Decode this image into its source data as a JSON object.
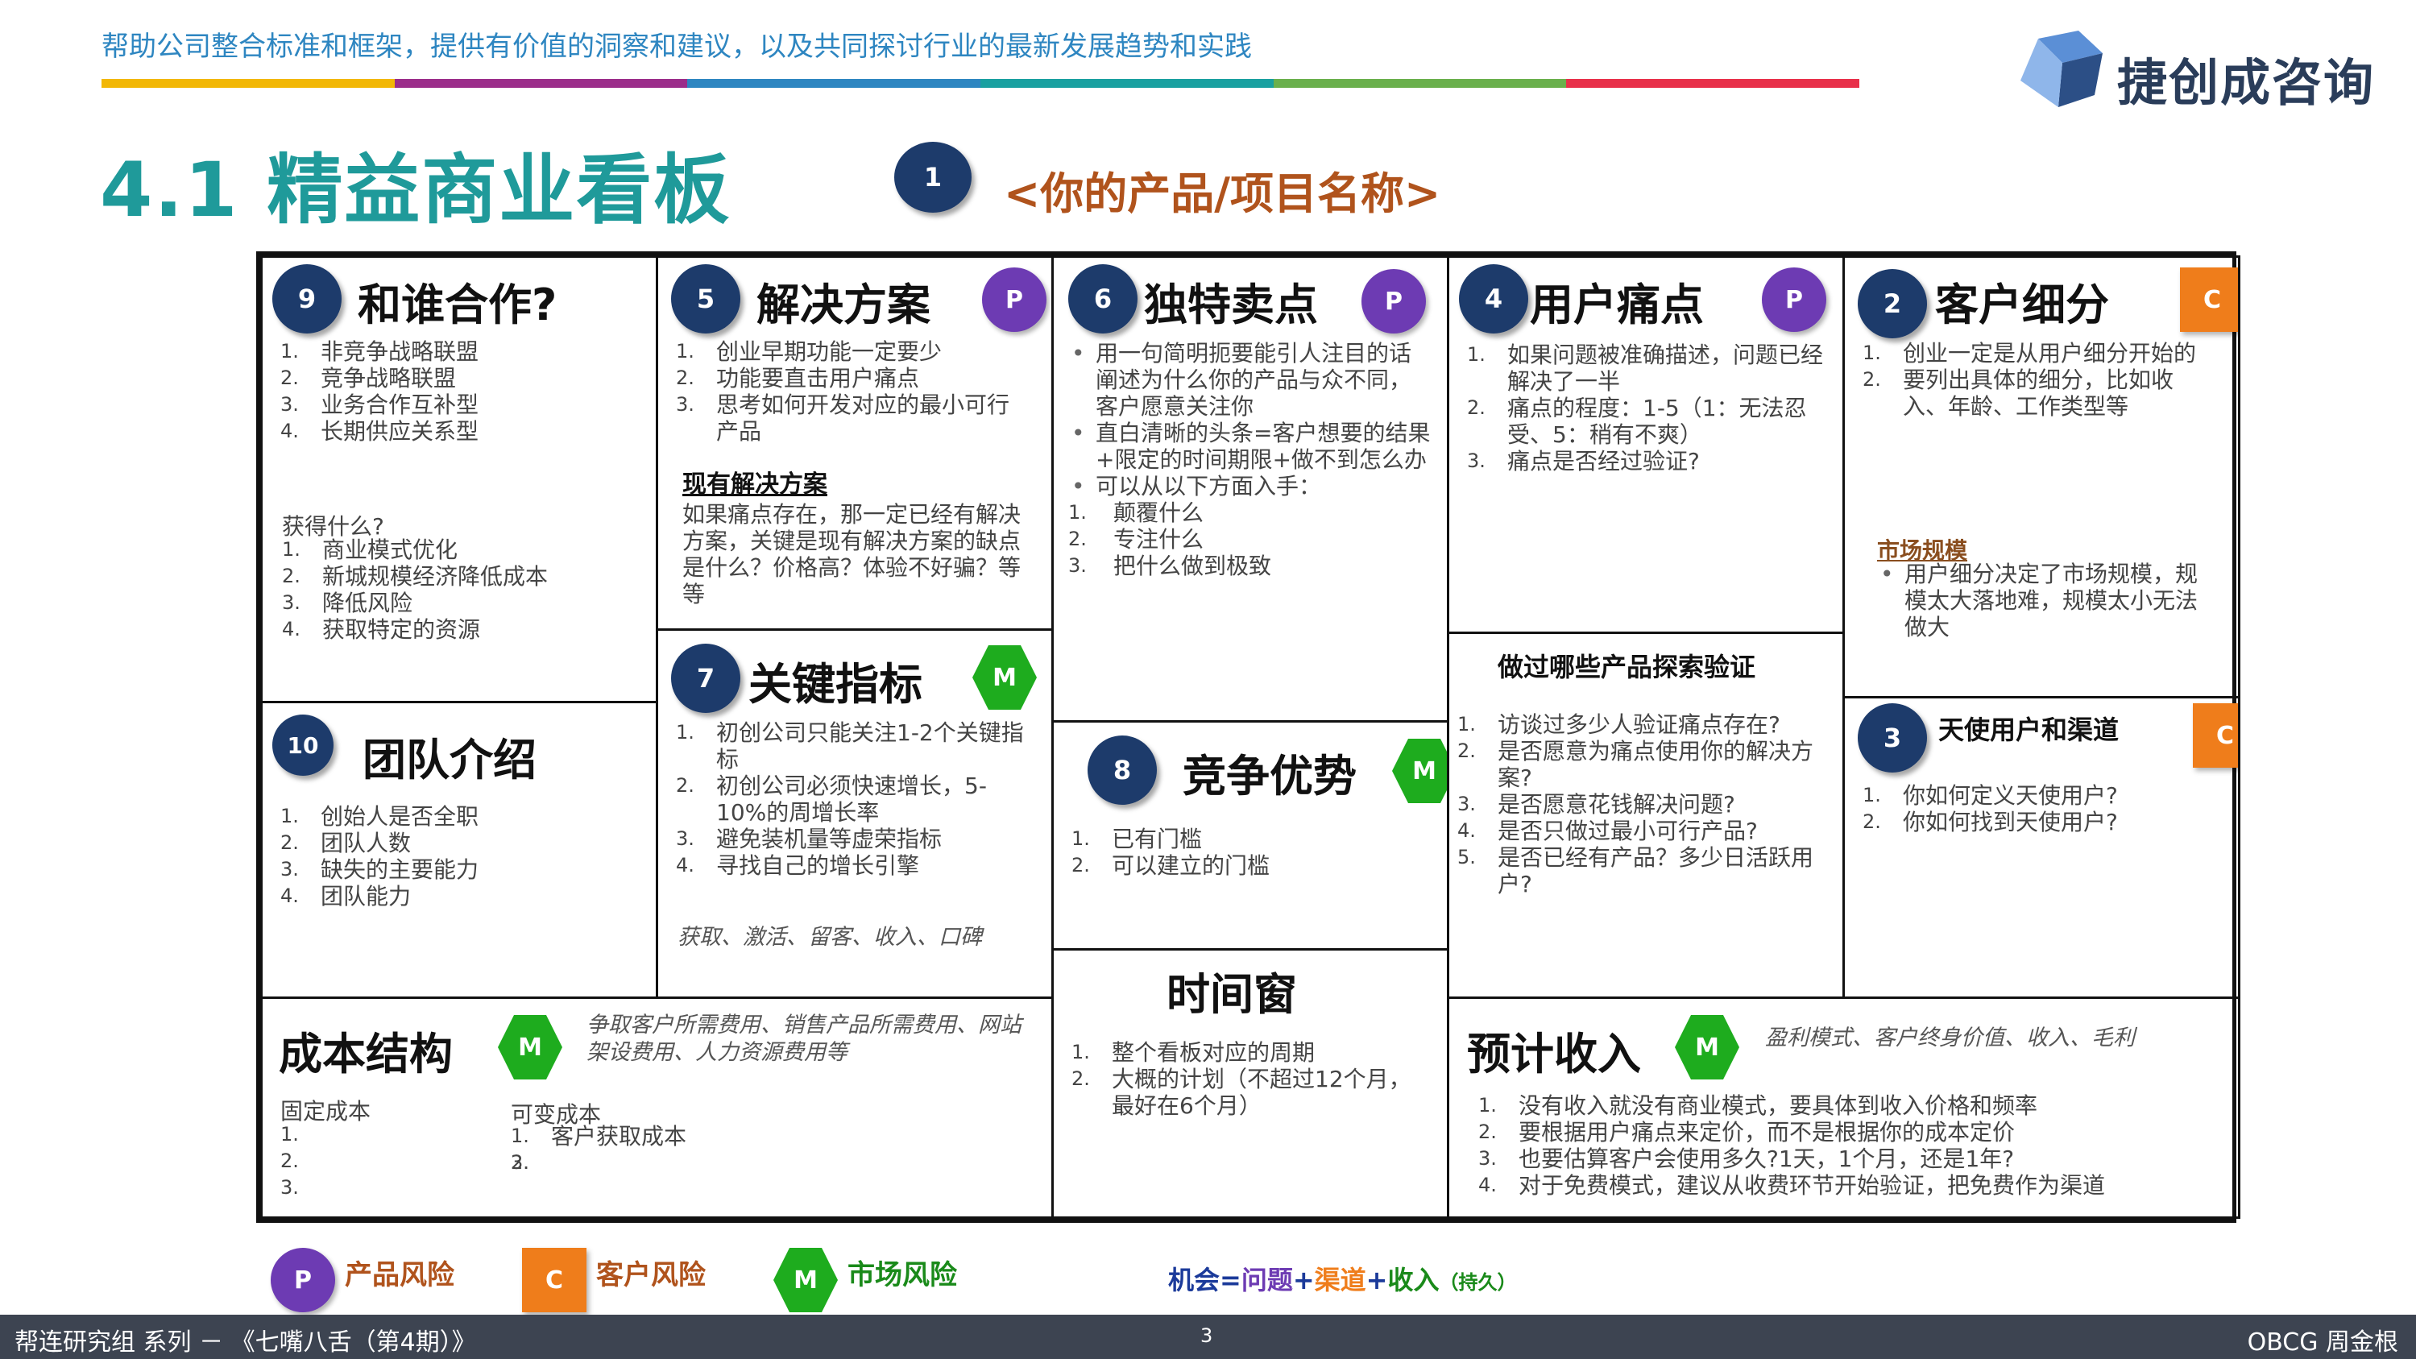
{
  "header": {
    "tagline": "帮助公司整合标准和框架，提供有价值的洞察和建议，以及共同探讨行业的最新发展趋势和实践",
    "logo_text": "捷创成咨询",
    "color_stripes": [
      "#f2b705",
      "#9b2d8a",
      "#2e86c1",
      "#19a0a0",
      "#6ab04c",
      "#e8304a"
    ]
  },
  "title": "4.1 精益商业看板",
  "product": {
    "badge": "1",
    "name": "<你的产品/项目名称>"
  },
  "cells": {
    "partners": {
      "badge": "9",
      "title": "和谁合作?",
      "items": [
        "非竞争战略联盟",
        "竞争战略联盟",
        "业务合作互补型",
        "长期供应关系型"
      ],
      "gain_label": "获得什么?",
      "gain_items": [
        "商业模式优化",
        "新城规模经济降低成本",
        "降低风险",
        "获取特定的资源"
      ]
    },
    "team": {
      "badge": "10",
      "title": "团队介绍",
      "items": [
        "创始人是否全职",
        "团队人数",
        "缺失的主要能力",
        "团队能力"
      ]
    },
    "solution": {
      "badge": "5",
      "title": "解决方案",
      "risk": "P",
      "items": [
        "创业早期功能一定要少",
        "功能要直击用户痛点",
        "思考如何开发对应的最小可行产品"
      ],
      "existing_label": "现有解决方案",
      "existing_text": "如果痛点存在，那一定已经有解决方案，关键是现有解决方案的缺点是什么？价格高？体验不好骗？等等"
    },
    "metrics": {
      "badge": "7",
      "title": "关键指标",
      "risk": "M",
      "items": [
        "初创公司只能关注1-2个关键指标",
        "初创公司必须快速增长，5-10%的周增长率",
        "避免装机量等虚荣指标",
        "寻找自己的增长引擎"
      ],
      "note": "获取、激活、留客、收入、口碑"
    },
    "usp": {
      "badge": "6",
      "title": "独特卖点",
      "risk": "P",
      "bullet1": "用一句简明扼要能引人注目的话阐述为什么你的产品与众不同，客户愿意关注你",
      "bullet2": "直白清晰的头条=客户想要的结果+限定的时间期限+做不到怎么办",
      "bullet3": "可以从以下方面入手：",
      "items": [
        "颠覆什么",
        "专注什么",
        "把什么做到极致"
      ]
    },
    "advantage": {
      "badge": "8",
      "title": "竞争优势",
      "risk": "M",
      "items": [
        "已有门槛",
        "可以建立的门槛"
      ]
    },
    "window": {
      "title": "时间窗",
      "items": [
        "整个看板对应的周期",
        "大概的计划（不超过12个月，最好在6个月）"
      ]
    },
    "pain": {
      "badge": "4",
      "title": "用户痛点",
      "risk": "P",
      "items": [
        "如果问题被准确描述，问题已经解决了一半",
        "痛点的程度：1-5（1：无法忍受、5：稍有不爽）",
        "痛点是否经过验证?"
      ]
    },
    "validation": {
      "title": "做过哪些产品探索验证",
      "items": [
        "访谈过多少人验证痛点存在?",
        "是否愿意为痛点使用你的解决方案?",
        "是否愿意花钱解决问题?",
        "是否只做过最小可行产品?",
        "是否已经有产品？多少日活跃用户?"
      ]
    },
    "segments": {
      "badge": "2",
      "title": "客户细分",
      "risk": "C",
      "items": [
        "创业一定是从用户细分开始的",
        "要列出具体的细分，比如收入、年龄、工作类型等"
      ],
      "market_label": "市场规模",
      "market_text": "用户细分决定了市场规模，规模太大落地难，规模太小无法做大"
    },
    "channels": {
      "badge": "3",
      "title": "天使用户和渠道",
      "risk": "C",
      "items": [
        "你如何定义天使用户?",
        "你如何找到天使用户?"
      ]
    },
    "cost": {
      "title": "成本结构",
      "risk": "M",
      "note": "争取客户所需费用、销售产品所需费用、网站架设费用、人力资源费用等",
      "fixed_label": "固定成本",
      "fixed_items": [
        "1.",
        "2.",
        "3."
      ],
      "variable_label": "可变成本",
      "variable_items": [
        "客户获取成本",
        "",
        ""
      ]
    },
    "revenue": {
      "title": "预计收入",
      "risk": "M",
      "note": "盈利模式、客户终身价值、收入、毛利",
      "items": [
        "没有收入就没有商业模式，要具体到收入价格和频率",
        "要根据用户痛点来定价，而不是根据你的成本定价",
        "也要估算客户会使用多久?1天，1个月，还是1年?",
        "对于免费模式，建议从收费环节开始验证，把免费作为渠道"
      ]
    }
  },
  "legend": {
    "p_letter": "P",
    "p_label": "产品风险",
    "c_letter": "C",
    "c_label": "客户风险",
    "m_letter": "M",
    "m_label": "市场风险",
    "formula": {
      "part1": "机会=",
      "part2": "问题",
      "plus1": "+",
      "part3": "渠道",
      "plus2": "+",
      "part4": "收入",
      "suffix": "（持久）"
    },
    "colors": {
      "p": "#6d3bb3",
      "c": "#ef7d1b",
      "m": "#1eac1e",
      "navy": "#1d3b6b"
    }
  },
  "footer": {
    "left": "帮连研究组 系列 － 《七嘴八舌（第4期）》",
    "page": "3",
    "right": "OBCG 周金根"
  }
}
